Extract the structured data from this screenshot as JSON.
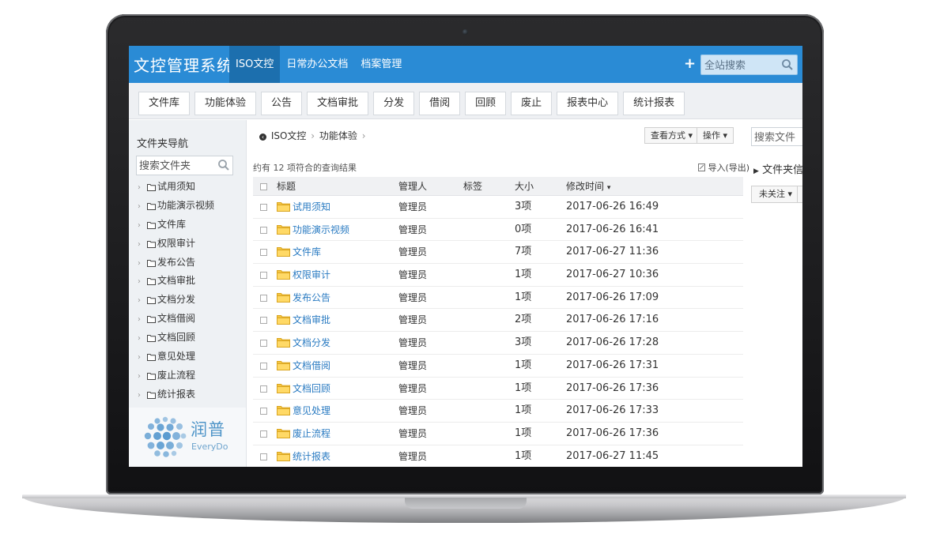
{
  "header": {
    "brand": "文控管理系统",
    "nav": [
      "ISO文控",
      "日常办公文档",
      "档案管理"
    ],
    "plus": "+",
    "search_placeholder": "全站搜索"
  },
  "tabs": [
    "文件库",
    "功能体验",
    "公告",
    "文档审批",
    "分发",
    "借阅",
    "回顾",
    "废止",
    "报表中心",
    "统计报表"
  ],
  "sidebar": {
    "title": "文件夹导航",
    "search_placeholder": "搜索文件夹",
    "folders": [
      "试用须知",
      "功能演示视频",
      "文件库",
      "权限审计",
      "发布公告",
      "文档审批",
      "文档分发",
      "文档借阅",
      "文档回顾",
      "意见处理",
      "废止流程",
      "统计报表"
    ],
    "logo_cn": "润普",
    "logo_en": "EveryDo"
  },
  "main": {
    "breadcrumb": [
      "ISO文控",
      "功能体验"
    ],
    "view_mode": "查看方式",
    "actions": "操作",
    "summary": "约有 12 项符合的查询结果",
    "import_export": "导入(导出)",
    "columns": {
      "title": "标题",
      "owner": "管理人",
      "tag": "标签",
      "size": "大小",
      "modified": "修改时间"
    },
    "rows": [
      {
        "title": "试用须知",
        "owner": "管理员",
        "tag": "",
        "size": "3项",
        "modified": "2017-06-26 16:49"
      },
      {
        "title": "功能演示视频",
        "owner": "管理员",
        "tag": "",
        "size": "0项",
        "modified": "2017-06-26 16:41"
      },
      {
        "title": "文件库",
        "owner": "管理员",
        "tag": "",
        "size": "7项",
        "modified": "2017-06-27 11:36"
      },
      {
        "title": "权限审计",
        "owner": "管理员",
        "tag": "",
        "size": "1项",
        "modified": "2017-06-27 10:36"
      },
      {
        "title": "发布公告",
        "owner": "管理员",
        "tag": "",
        "size": "1项",
        "modified": "2017-06-26 17:09"
      },
      {
        "title": "文档审批",
        "owner": "管理员",
        "tag": "",
        "size": "2项",
        "modified": "2017-06-26 17:16"
      },
      {
        "title": "文档分发",
        "owner": "管理员",
        "tag": "",
        "size": "3项",
        "modified": "2017-06-26 17:28"
      },
      {
        "title": "文档借阅",
        "owner": "管理员",
        "tag": "",
        "size": "1项",
        "modified": "2017-06-26 17:31"
      },
      {
        "title": "文档回顾",
        "owner": "管理员",
        "tag": "",
        "size": "1项",
        "modified": "2017-06-26 17:36"
      },
      {
        "title": "意见处理",
        "owner": "管理员",
        "tag": "",
        "size": "1项",
        "modified": "2017-06-26 17:33"
      },
      {
        "title": "废止流程",
        "owner": "管理员",
        "tag": "",
        "size": "1项",
        "modified": "2017-06-26 17:36"
      },
      {
        "title": "统计报表",
        "owner": "管理员",
        "tag": "",
        "size": "1项",
        "modified": "2017-06-27 11:45"
      }
    ]
  },
  "right_panel": {
    "search_placeholder": "搜索文件",
    "folder_info": "文件夹信息",
    "follow": "未关注"
  },
  "colors": {
    "accent": "#2a8bd5",
    "accent_dark": "#1c6fae",
    "link": "#2a7bc2",
    "folder": "#f5c542"
  }
}
